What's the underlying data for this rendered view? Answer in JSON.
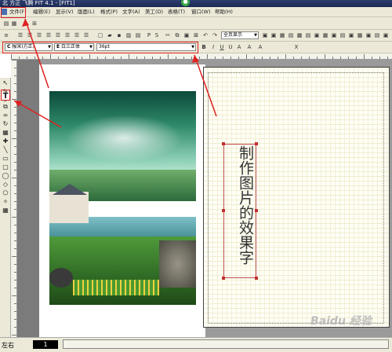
{
  "titlebar": {
    "title": "北 方正 飞腾 FIT 4.1 - [FIT1]"
  },
  "menu": {
    "items": [
      "文件(F)",
      "编辑(E)",
      "显示(V)",
      "版面(L)",
      "格式(P)",
      "文字(A)",
      "美工(D)",
      "表格(T)",
      "窗口(W)",
      "帮助(H)"
    ]
  },
  "toolbar": {
    "zoom_label": "全页显示",
    "font_cn_label": "报宋",
    "font_cn_sub": "(方正)",
    "font_en_label": "E",
    "font_en_value": "白三正体",
    "font_size_value": "36pt",
    "style_buttons": [
      "B",
      "I",
      "U",
      "U",
      "A",
      "A",
      "A",
      "X"
    ]
  },
  "content": {
    "vertical_text": "制作图片的效果字"
  },
  "statusbar": {
    "left_label": "左右",
    "page_number": "1"
  },
  "watermark": {
    "text": "Baidu 经验"
  },
  "colors": {
    "accent": "#e02020",
    "titlebar": "#1c2a55",
    "chrome": "#ece9d8"
  }
}
